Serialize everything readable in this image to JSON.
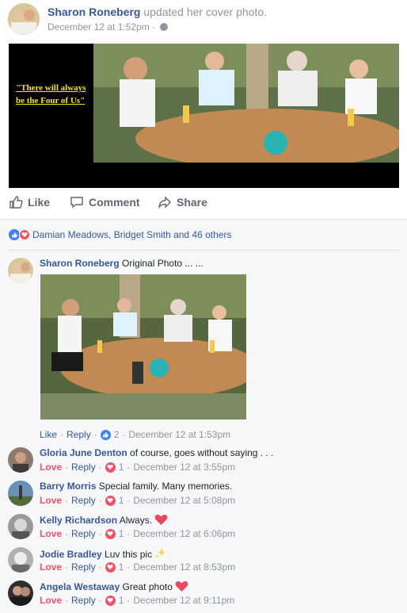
{
  "post": {
    "author": "Sharon Roneberg",
    "action": "updated her cover photo.",
    "time": "December 12 at 1:52pm",
    "cover_quote": "\"There will always be the Four of Us\""
  },
  "actions": {
    "like": "Like",
    "comment": "Comment",
    "share": "Share"
  },
  "reactions": {
    "summary": "Damian Meadows, Bridget Smith and 46 others"
  },
  "colors": {
    "link": "#365899",
    "love": "#f25268",
    "like_blue": "#4080ff",
    "meta": "#90949c"
  },
  "comments": [
    {
      "name": "Sharon Roneberg",
      "text": "Original Photo ... ...",
      "meta_like": "Like",
      "meta_reply": "Reply",
      "react_icon": "like-icon",
      "react_count": "2",
      "time": "December 12 at 1:53pm"
    },
    {
      "name": "Gloria June Denton",
      "text": "of course, goes without saying . . .",
      "meta_like": "Love",
      "meta_reply": "Reply",
      "react_icon": "love-icon",
      "react_count": "1",
      "time": "December 12 at 3:55pm"
    },
    {
      "name": "Barry Morris",
      "text": "Special family. Many memories.",
      "meta_like": "Love",
      "meta_reply": "Reply",
      "react_icon": "love-icon",
      "react_count": "1",
      "time": "December 12 at 5:08pm"
    },
    {
      "name": "Kelly Richardson",
      "text": "Always.",
      "emoji": "heart-emoji",
      "meta_like": "Love",
      "meta_reply": "Reply",
      "react_icon": "love-icon",
      "react_count": "1",
      "time": "December 12 at 6:06pm"
    },
    {
      "name": "Jodie Bradley",
      "text": "Luv this pic",
      "emoji": "sparkles-emoji",
      "meta_like": "Love",
      "meta_reply": "Reply",
      "react_icon": "love-icon",
      "react_count": "1",
      "time": "December 12 at 8:53pm"
    },
    {
      "name": "Angela Westaway",
      "text": "Great photo",
      "emoji": "heart-emoji",
      "meta_like": "Love",
      "meta_reply": "Reply",
      "react_icon": "love-icon",
      "react_count": "1",
      "time": "December 12 at 9:11pm"
    }
  ]
}
